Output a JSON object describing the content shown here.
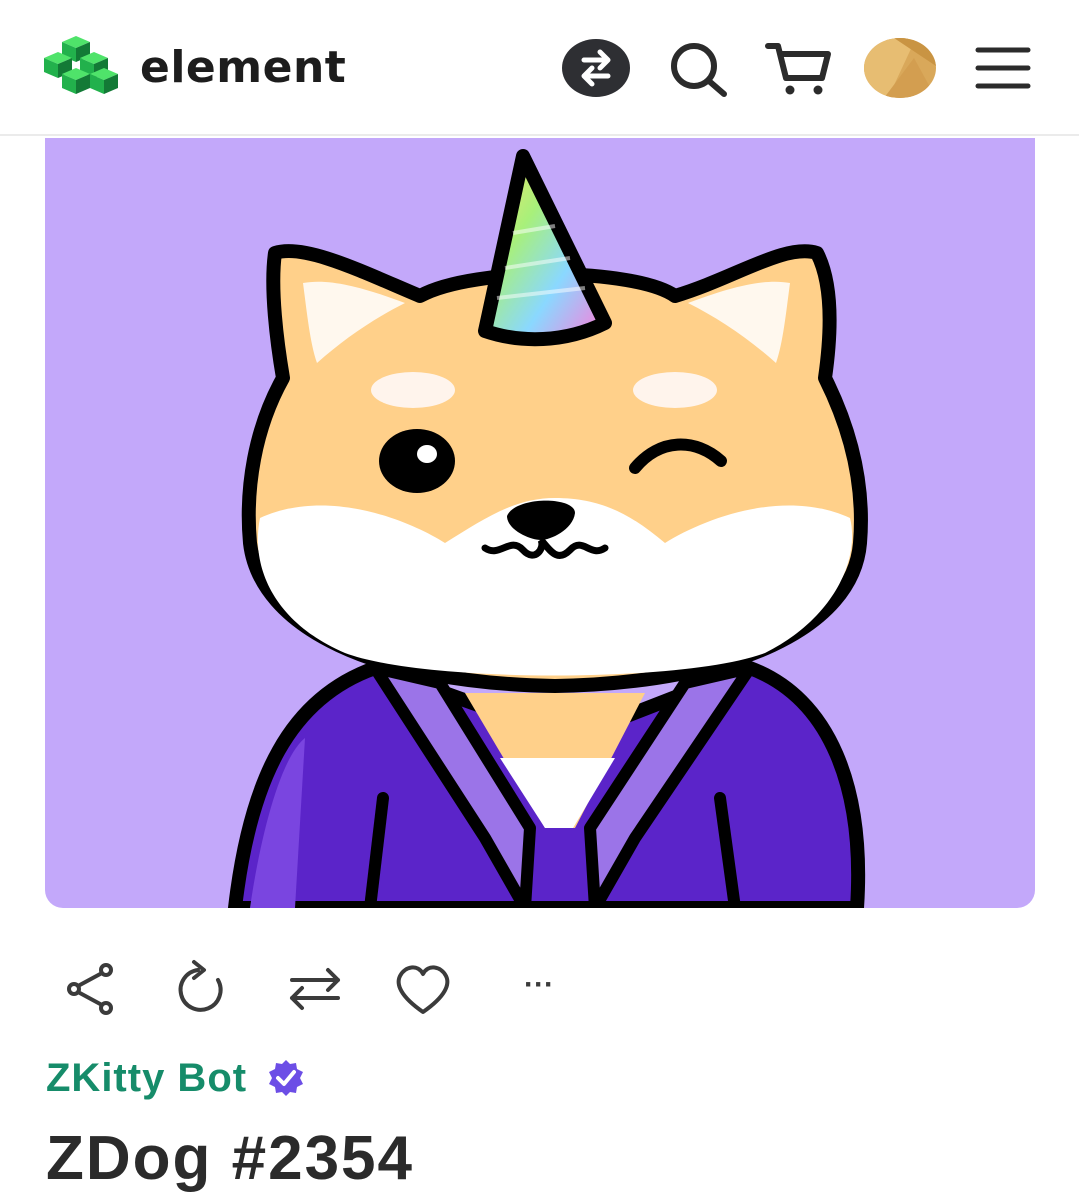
{
  "header": {
    "brand": "element",
    "icons": [
      "cube-logo-icon",
      "swap-icon",
      "search-icon",
      "cart-icon",
      "avatar",
      "menu-icon"
    ],
    "accent": "#1fc14a"
  },
  "nft": {
    "background_color": "#c3a8fa"
  },
  "actions": {
    "icons": [
      "share-icon",
      "refresh-icon",
      "transfer-icon",
      "heart-icon",
      "more-icon"
    ],
    "more_label": "···"
  },
  "collection": {
    "name": "ZKitty Bot",
    "verified": true,
    "color": "#168c6a"
  },
  "token": {
    "title": "ZDog #2354"
  }
}
